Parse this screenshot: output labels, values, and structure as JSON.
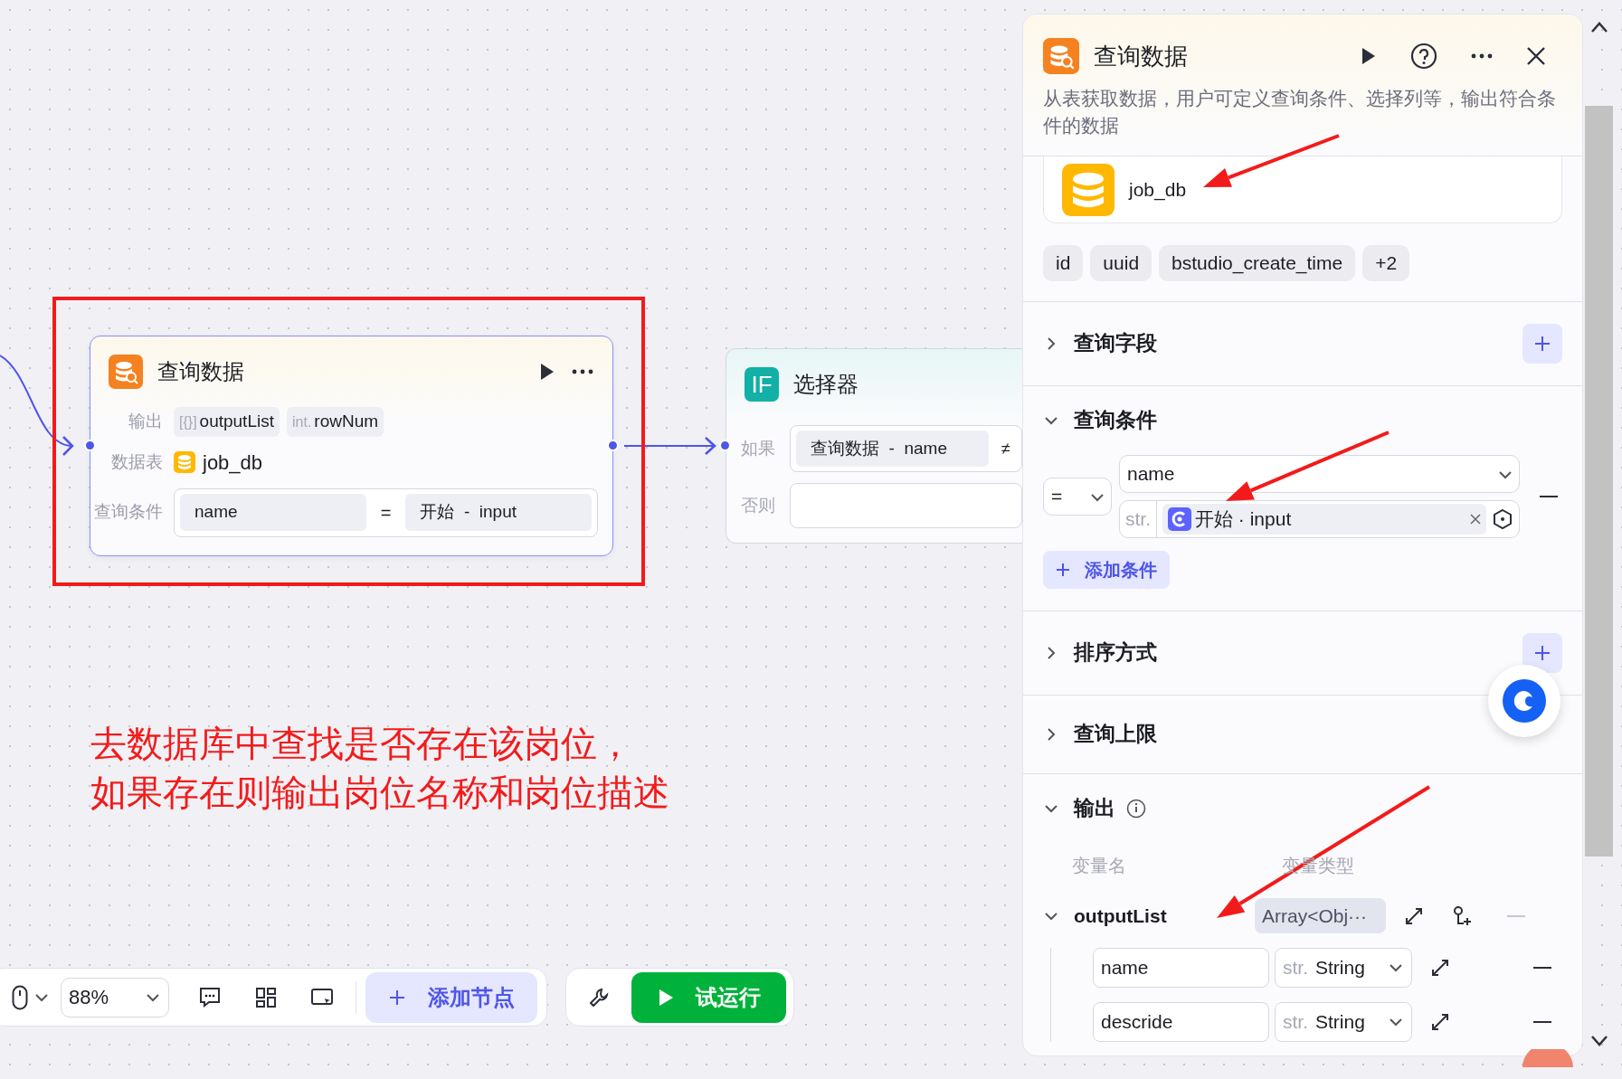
{
  "query_node": {
    "title": "查询数据",
    "output_label": "输出",
    "outputs": [
      {
        "type": "[{}]",
        "name": "outputList"
      },
      {
        "type": "int.",
        "name": "rowNum"
      }
    ],
    "table_label": "数据表",
    "table": "job_db",
    "condition_label": "查询条件",
    "condition": {
      "left": "name",
      "operator": "=",
      "right": "开始  -  input"
    }
  },
  "selector_node": {
    "icon": "IF",
    "title": "选择器",
    "if_label": "如果",
    "if_value": "查询数据  -  name",
    "operator": "≠",
    "else_label": "否则"
  },
  "annotation": {
    "lines": [
      "去数据库中查找是否存在该岗位，",
      "如果存在则输出岗位名称和岗位描述"
    ]
  },
  "toolbar": {
    "zoom": "88%",
    "add_node": "添加节点",
    "run": "试运行"
  },
  "panel": {
    "title": "查询数据",
    "description": "从表获取数据，用户可定义查询条件、选择列等，输出符合条件的数据",
    "table": "job_db",
    "columns": [
      "id",
      "uuid",
      "bstudio_create_time",
      "+2"
    ],
    "sections": [
      {
        "kind": "fields",
        "title": "查询字段",
        "expanded": false
      },
      {
        "kind": "conditions",
        "title": "查询条件",
        "expanded": true,
        "operator": "=",
        "field": "name",
        "value_type": "str.",
        "value": "开始 · input",
        "add": "添加条件"
      },
      {
        "kind": "sort",
        "title": "排序方式",
        "expanded": false
      },
      {
        "kind": "limit",
        "title": "查询上限",
        "expanded": false
      },
      {
        "kind": "output",
        "title": "输出",
        "expanded": true,
        "headers": [
          "变量名",
          "变量类型"
        ],
        "variables": [
          {
            "name": "outputList",
            "type": "Array<Obj···",
            "expanded": true,
            "children": [
              {
                "name": "name",
                "type_prefix": "str.",
                "type": "String"
              },
              {
                "name": "descride",
                "type_prefix": "str.",
                "type": "String"
              }
            ]
          }
        ]
      }
    ]
  }
}
